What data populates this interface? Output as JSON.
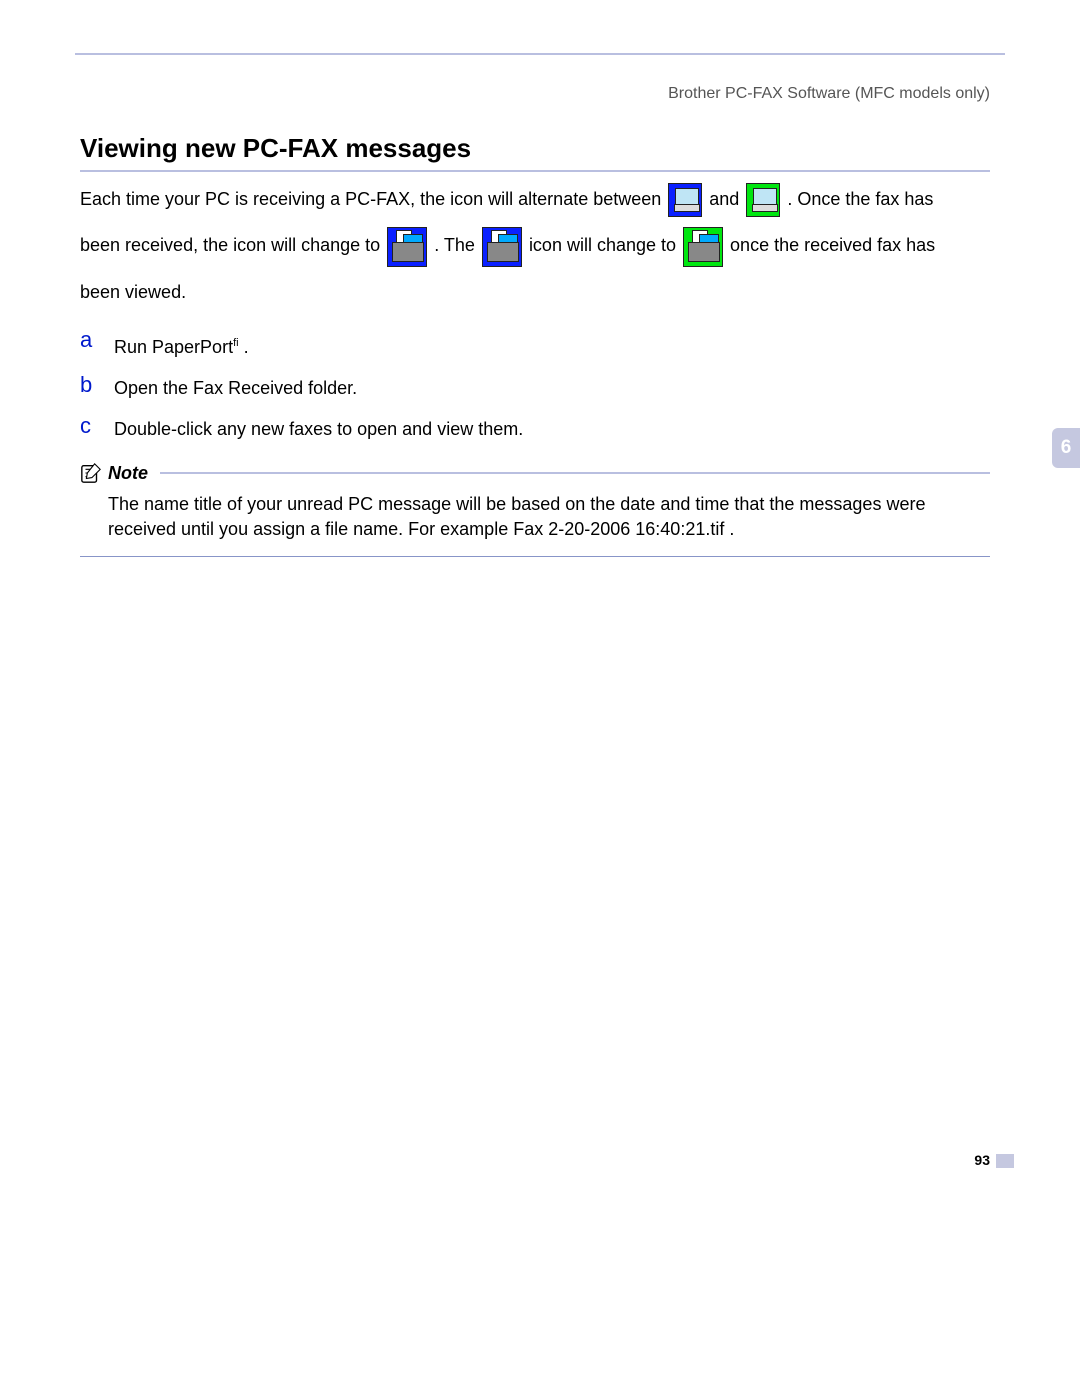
{
  "header": "Brother PC-FAX Software (MFC models only)",
  "title": "Viewing new PC-FAX messages",
  "para1a": "Each time your PC is receiving a PC-FAX, the icon will alternate between ",
  "para1b": " and ",
  "para1c": ". Once the fax has",
  "para2a": "been received, the icon will change to ",
  "para2b": ". The ",
  "para2c": " icon will change to ",
  "para2d": " once the received fax has",
  "para3": "been viewed.",
  "steps": [
    {
      "letter": "a",
      "text": "Run PaperPort",
      "sup": "fi",
      "after": " ."
    },
    {
      "letter": "b",
      "text": "Open the Fax Received folder."
    },
    {
      "letter": "c",
      "text": "Double-click any new faxes to open and view them."
    }
  ],
  "noteLabel": "Note",
  "noteText": "The name title of your unread PC message will be based on the date and time that the messages were received until you assign a file name. For example  Fax 2-20-2006 16:40:21.tif .",
  "chapter": "6",
  "pageNumber": "93"
}
